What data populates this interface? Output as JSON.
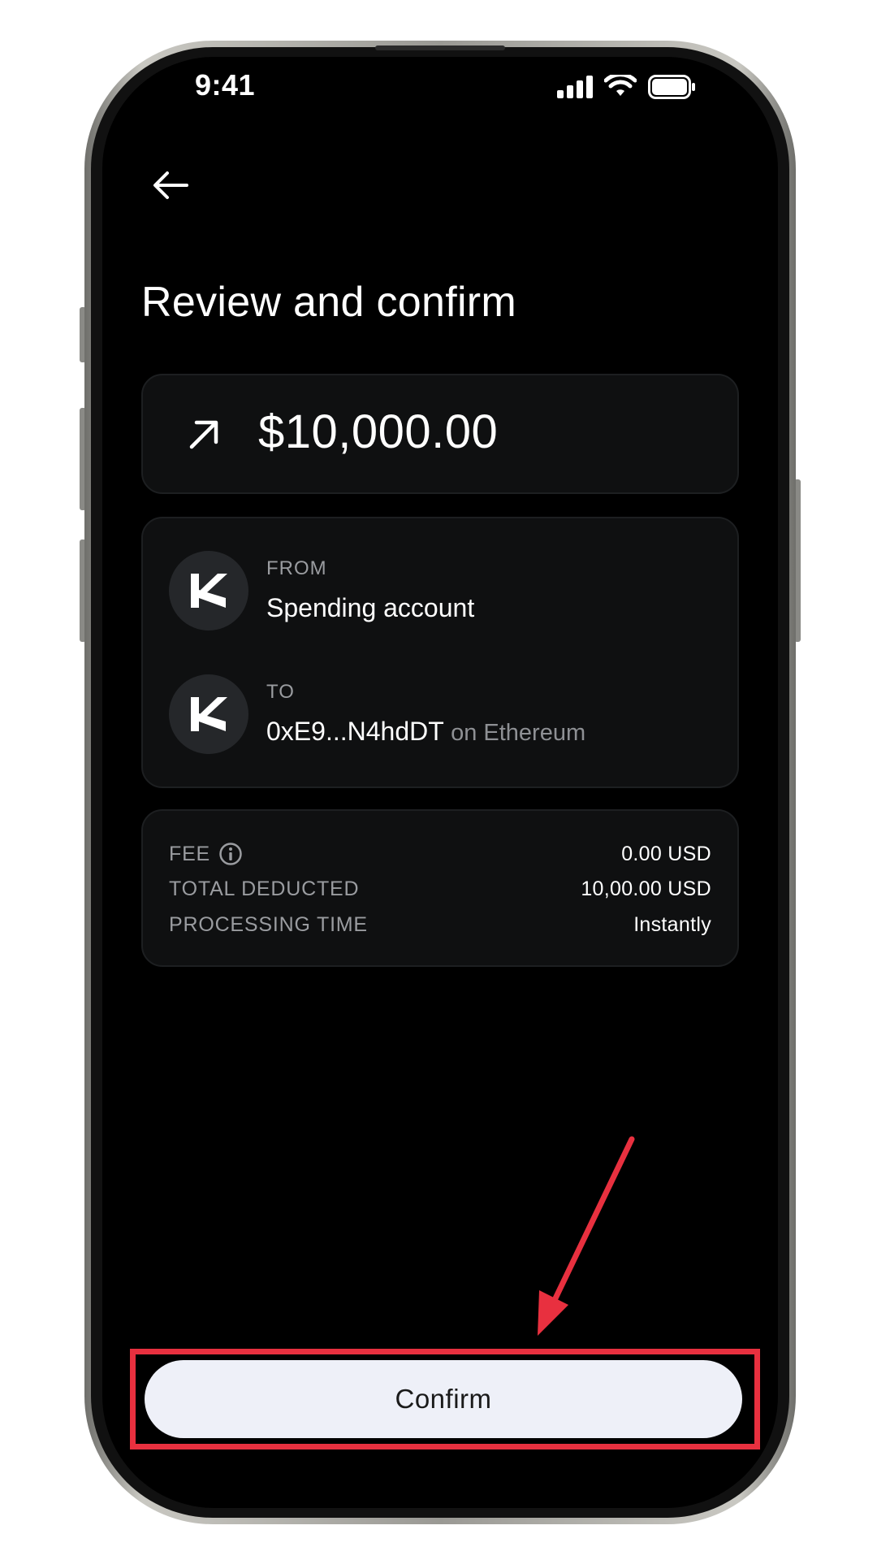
{
  "status_bar": {
    "time": "9:41"
  },
  "header": {
    "back_icon": "arrow-left-icon",
    "title": "Review and confirm"
  },
  "amount_card": {
    "direction_icon": "arrow-up-right-icon",
    "amount": "$10,000.00"
  },
  "transfer": {
    "from": {
      "label": "FROM",
      "account": "Spending account",
      "avatar_icon": "k-logo-icon"
    },
    "to": {
      "label": "TO",
      "address": "0xE9...N4hdDT",
      "network": "on Ethereum",
      "avatar_icon": "k-logo-icon"
    }
  },
  "fees": [
    {
      "label": "FEE",
      "value": "0.00 USD",
      "has_info": true
    },
    {
      "label": "TOTAL DEDUCTED",
      "value": "10,00.00 USD",
      "has_info": false
    },
    {
      "label": "PROCESSING TIME",
      "value": "Instantly",
      "has_info": false
    }
  ],
  "actions": {
    "confirm_label": "Confirm"
  },
  "colors": {
    "background": "#000000",
    "card": "#0f1011",
    "button": "#eef0f8",
    "annotation": "#e8303f"
  }
}
